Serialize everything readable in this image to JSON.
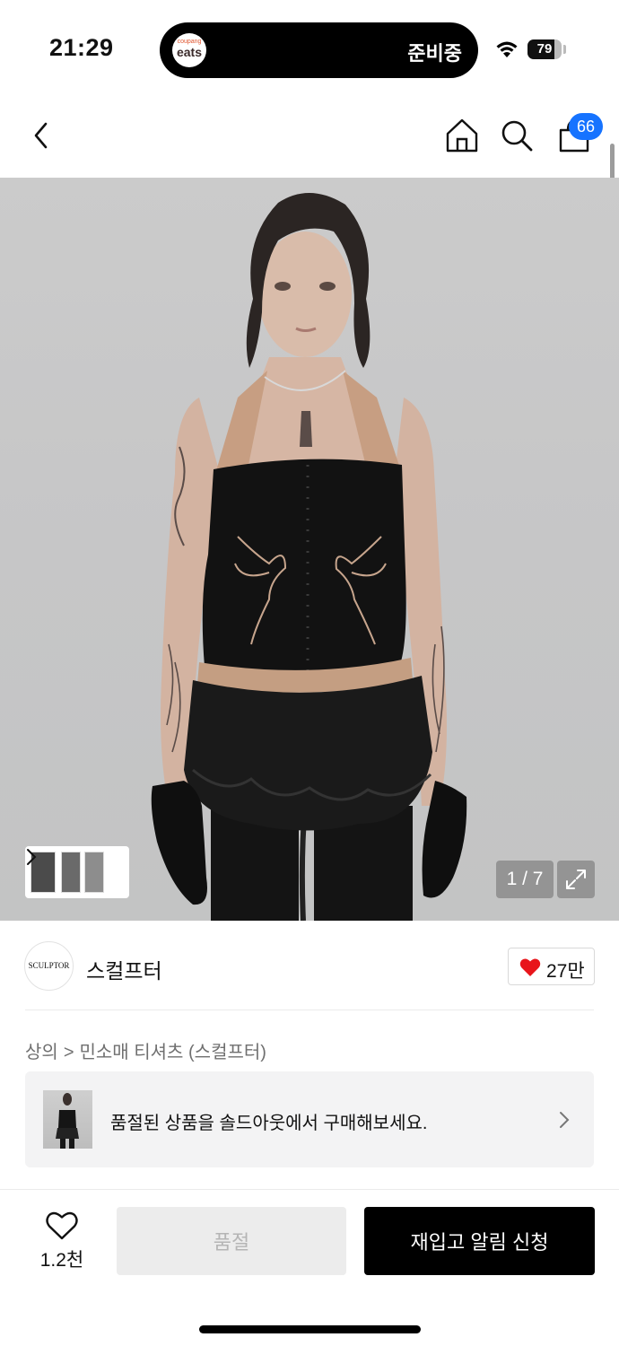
{
  "status_bar": {
    "time": "21:29",
    "island_app_small": "coupang",
    "island_app_name": "eats",
    "island_status": "준비중",
    "battery_level": "79",
    "battery_fraction": 0.79
  },
  "nav": {
    "cart_count": "66"
  },
  "gallery": {
    "counter": "1 / 7",
    "thumbnail_count": 3
  },
  "brand": {
    "logo_text": "SCULPTOR",
    "name": "스컬프터",
    "like_count": "27만"
  },
  "breadcrumb": {
    "category": "상의",
    "separator": ">",
    "subcategory": "민소매 티셔츠 (스컬프터)"
  },
  "soldout_banner": {
    "text": "품절된 상품을 솔드아웃에서 구매해보세요."
  },
  "bottom_bar": {
    "wish_count": "1.2천",
    "soldout_label": "품절",
    "restock_label": "재입고 알림 신청"
  },
  "colors": {
    "badge": "#1673ff",
    "heart": "#e8151b",
    "primary_button": "#000000",
    "disabled_button": "#ececec"
  }
}
